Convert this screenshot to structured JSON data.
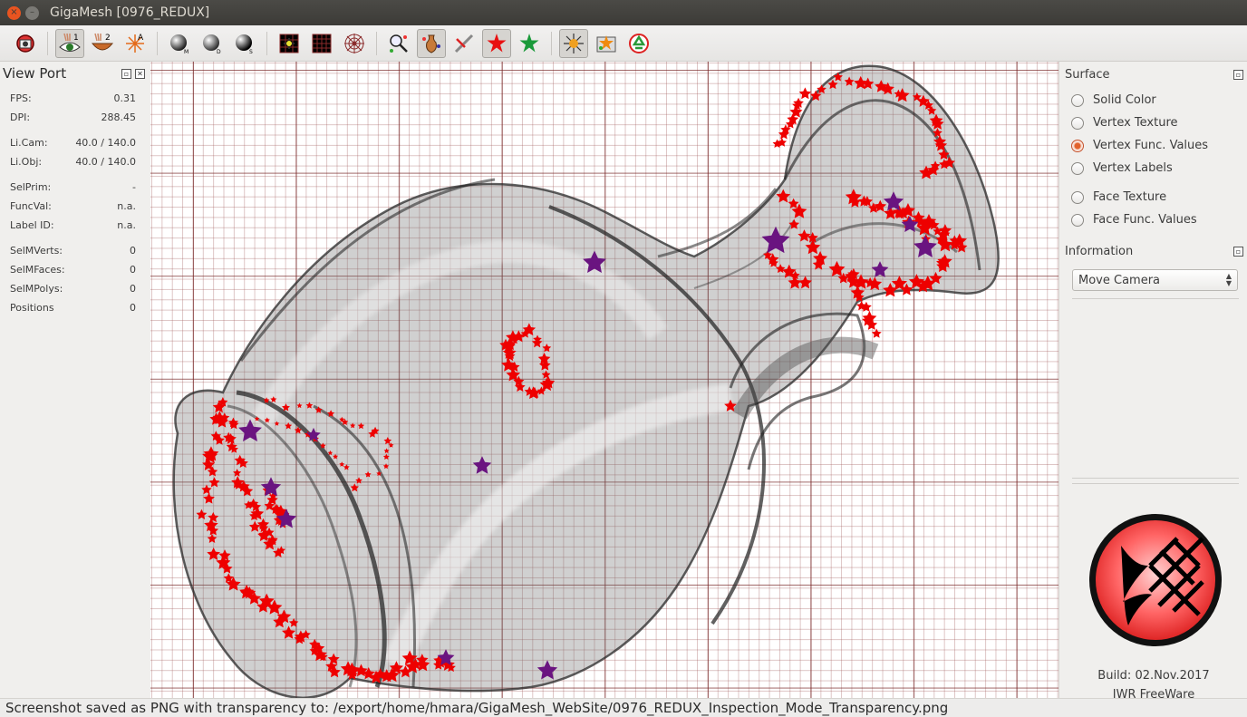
{
  "window": {
    "title": "GigaMesh [0976_REDUX]",
    "close_glyph": "×",
    "min_glyph": "–"
  },
  "toolbar": {
    "icons": [
      "home-view-icon",
      "inspection-eye-icon",
      "bowl-2-icon",
      "light-a-icon",
      "sphere-m-icon",
      "sphere-d-icon",
      "sphere-s-icon",
      "grid-cross-icon",
      "grid-icon",
      "polar-grid-icon",
      "select-wand-icon",
      "vase-stars-icon",
      "cut-icon",
      "red-star-icon",
      "green-star-icon",
      "light-spot-icon",
      "screenshot-icon",
      "recycle-icon"
    ]
  },
  "viewport_panel": {
    "title": "View Port",
    "rows": [
      {
        "label": "FPS:",
        "value": "0.31"
      },
      {
        "label": "DPI:",
        "value": "288.45"
      },
      {
        "label": "Li.Cam:",
        "value": "40.0 / 140.0"
      },
      {
        "label": "Li.Obj:",
        "value": "40.0 / 140.0"
      },
      {
        "label": "SelPrim:",
        "value": "-"
      },
      {
        "label": "FuncVal:",
        "value": "n.a."
      },
      {
        "label": "Label ID:",
        "value": "n.a."
      },
      {
        "label": "SelMVerts:",
        "value": "0"
      },
      {
        "label": "SelMFaces:",
        "value": "0"
      },
      {
        "label": "SelMPolys:",
        "value": "0"
      },
      {
        "label": "Positions",
        "value": "0"
      }
    ]
  },
  "surface_panel": {
    "title": "Surface",
    "options": [
      {
        "label": "Solid Color",
        "selected": false
      },
      {
        "label": "Vertex Texture",
        "selected": false
      },
      {
        "label": "Vertex Func. Values",
        "selected": true
      },
      {
        "label": "Vertex Labels",
        "selected": false
      },
      {
        "label": "Face Texture",
        "selected": false
      },
      {
        "label": "Face Func. Values",
        "selected": false
      }
    ]
  },
  "information_panel": {
    "title": "Information",
    "mode_selected": "Move Camera"
  },
  "about": {
    "build": "Build: 02.Nov.2017",
    "license": "IWR FreeWare"
  },
  "statusbar": {
    "message": "Screenshot saved as PNG with transparency to: /export/home/hmara/GigaMesh_WebSite/0976_REDUX_Inspection_Mode_Transparency.png"
  },
  "colors": {
    "marker_red": "#ee0000",
    "marker_purple": "#6a1480",
    "grid": "#7a2828",
    "accent": "#e95420"
  }
}
